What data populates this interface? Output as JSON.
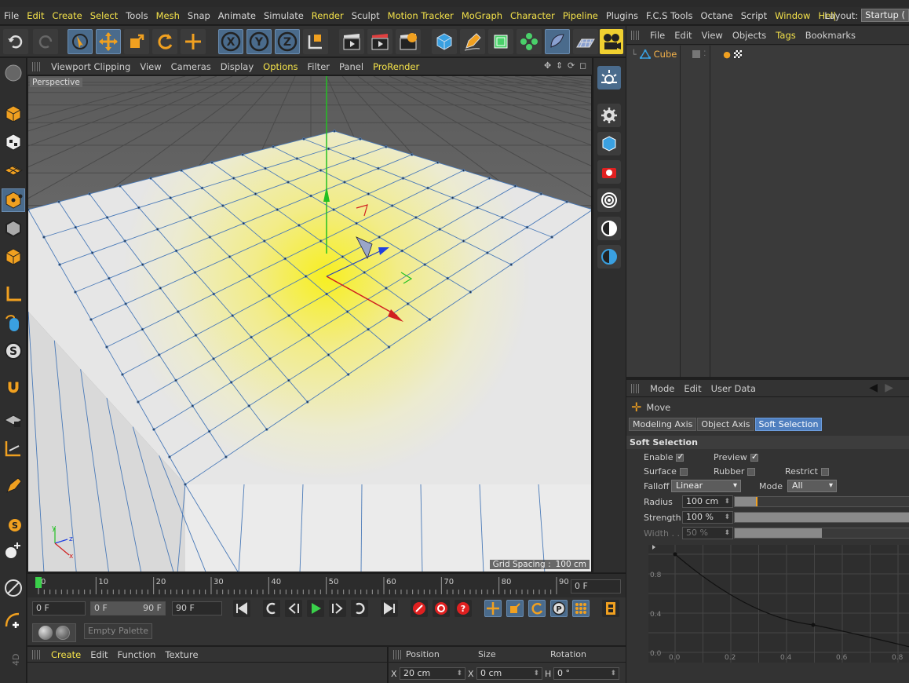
{
  "menubar": {
    "items": [
      {
        "label": "File",
        "hl": false
      },
      {
        "label": "Edit",
        "hl": true
      },
      {
        "label": "Create",
        "hl": true
      },
      {
        "label": "Select",
        "hl": true
      },
      {
        "label": "Tools",
        "hl": false
      },
      {
        "label": "Mesh",
        "hl": true
      },
      {
        "label": "Snap",
        "hl": false
      },
      {
        "label": "Animate",
        "hl": false
      },
      {
        "label": "Simulate",
        "hl": false
      },
      {
        "label": "Render",
        "hl": true
      },
      {
        "label": "Sculpt",
        "hl": false
      },
      {
        "label": "Motion Tracker",
        "hl": true
      },
      {
        "label": "MoGraph",
        "hl": true
      },
      {
        "label": "Character",
        "hl": true
      },
      {
        "label": "Pipeline",
        "hl": true
      },
      {
        "label": "Plugins",
        "hl": false
      },
      {
        "label": "F.C.S Tools",
        "hl": false
      },
      {
        "label": "Octane",
        "hl": false
      },
      {
        "label": "Script",
        "hl": false
      },
      {
        "label": "Window",
        "hl": true
      },
      {
        "label": "Hel|",
        "hl": true
      }
    ],
    "layout_label": "Layout:",
    "layout_value": "Startup ("
  },
  "viewport": {
    "menu": [
      "Viewport Clipping",
      "View",
      "Cameras",
      "Display",
      "Options",
      "Filter",
      "Panel",
      "ProRender"
    ],
    "menu_highlight": [
      "Options",
      "ProRender"
    ],
    "camera_label": "Perspective",
    "grid_spacing_label": "Grid Spacing :",
    "grid_spacing_value": "100 cm"
  },
  "object_manager": {
    "menu": [
      "File",
      "Edit",
      "View",
      "Objects",
      "Tags",
      "Bookmarks"
    ],
    "menu_highlight": [
      "Tags"
    ],
    "object_name": "Cube"
  },
  "attribute_manager": {
    "menu": [
      "Mode",
      "Edit",
      "User Data"
    ],
    "tool_name": "Move",
    "tabs": [
      "Modeling Axis",
      "Object Axis",
      "Soft Selection"
    ],
    "active_tab": "Soft Selection",
    "section_title": "Soft Selection",
    "enable_label": "Enable",
    "enable_checked": true,
    "preview_label": "Preview",
    "preview_checked": true,
    "surface_label": "Surface",
    "rubber_label": "Rubber",
    "restrict_label": "Restrict",
    "falloff_label": "Falloff",
    "falloff_value": "Linear",
    "mode_label": "Mode",
    "mode_value": "All",
    "radius_label": "Radius",
    "radius_value": "100 cm",
    "strength_label": "Strength",
    "strength_value": "100 %",
    "strength_fraction": 1.0,
    "width_label": "Width . .",
    "width_value": "50 %",
    "width_fraction": 0.5,
    "graph_y_ticks": [
      "0.8",
      "0.4",
      "0.0"
    ],
    "graph_x_ticks": [
      "0.0",
      "0.2",
      "0.4",
      "0.6",
      "0.8"
    ]
  },
  "timeline": {
    "ticks": [
      "0",
      "10",
      "20",
      "30",
      "40",
      "50",
      "60",
      "70",
      "80",
      "90"
    ],
    "current_frame": "0 F",
    "start_field": "0 F",
    "range_start": "0 F",
    "range_end": "90 F",
    "end_field": "90 F"
  },
  "palette": {
    "label": "Empty Palette"
  },
  "material_manager": {
    "menu": [
      "Create",
      "Edit",
      "Function",
      "Texture"
    ],
    "menu_highlight": [
      "Create"
    ]
  },
  "coordinates": {
    "headers": [
      "Position",
      "Size",
      "Rotation"
    ],
    "x_pos": "20 cm",
    "x_size": "0 cm",
    "h_rot": "0 °",
    "x_label": "X",
    "x2_label": "X",
    "h_label": "H"
  },
  "app_label": "4D",
  "colors": {
    "highlight": "#f4e24a",
    "tab_active": "#4f7fbf",
    "icon_orange": "#f0a020",
    "icon_blue": "#3aa0e0"
  }
}
